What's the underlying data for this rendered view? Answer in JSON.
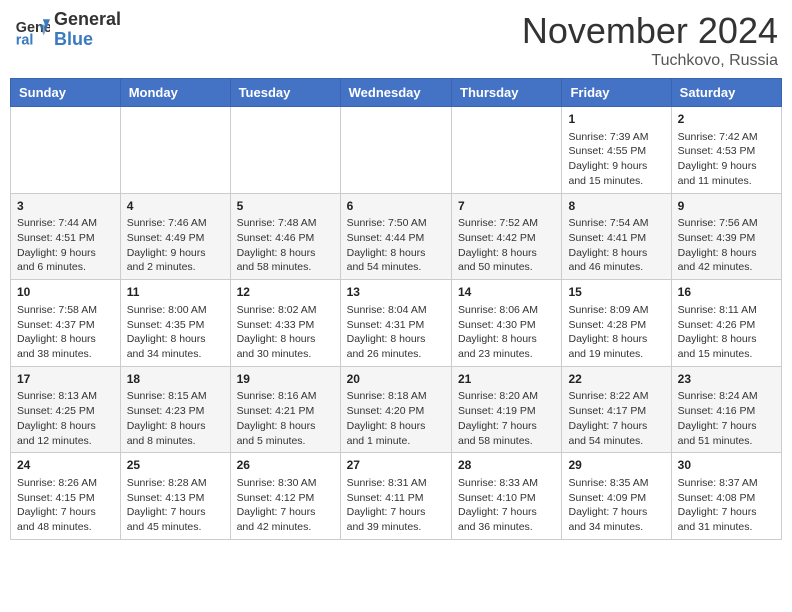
{
  "header": {
    "logo_general": "General",
    "logo_blue": "Blue",
    "month_title": "November 2024",
    "location": "Tuchkovo, Russia"
  },
  "weekdays": [
    "Sunday",
    "Monday",
    "Tuesday",
    "Wednesday",
    "Thursday",
    "Friday",
    "Saturday"
  ],
  "weeks": [
    [
      {
        "day": "",
        "info": ""
      },
      {
        "day": "",
        "info": ""
      },
      {
        "day": "",
        "info": ""
      },
      {
        "day": "",
        "info": ""
      },
      {
        "day": "",
        "info": ""
      },
      {
        "day": "1",
        "info": "Sunrise: 7:39 AM\nSunset: 4:55 PM\nDaylight: 9 hours and 15 minutes."
      },
      {
        "day": "2",
        "info": "Sunrise: 7:42 AM\nSunset: 4:53 PM\nDaylight: 9 hours and 11 minutes."
      }
    ],
    [
      {
        "day": "3",
        "info": "Sunrise: 7:44 AM\nSunset: 4:51 PM\nDaylight: 9 hours and 6 minutes."
      },
      {
        "day": "4",
        "info": "Sunrise: 7:46 AM\nSunset: 4:49 PM\nDaylight: 9 hours and 2 minutes."
      },
      {
        "day": "5",
        "info": "Sunrise: 7:48 AM\nSunset: 4:46 PM\nDaylight: 8 hours and 58 minutes."
      },
      {
        "day": "6",
        "info": "Sunrise: 7:50 AM\nSunset: 4:44 PM\nDaylight: 8 hours and 54 minutes."
      },
      {
        "day": "7",
        "info": "Sunrise: 7:52 AM\nSunset: 4:42 PM\nDaylight: 8 hours and 50 minutes."
      },
      {
        "day": "8",
        "info": "Sunrise: 7:54 AM\nSunset: 4:41 PM\nDaylight: 8 hours and 46 minutes."
      },
      {
        "day": "9",
        "info": "Sunrise: 7:56 AM\nSunset: 4:39 PM\nDaylight: 8 hours and 42 minutes."
      }
    ],
    [
      {
        "day": "10",
        "info": "Sunrise: 7:58 AM\nSunset: 4:37 PM\nDaylight: 8 hours and 38 minutes."
      },
      {
        "day": "11",
        "info": "Sunrise: 8:00 AM\nSunset: 4:35 PM\nDaylight: 8 hours and 34 minutes."
      },
      {
        "day": "12",
        "info": "Sunrise: 8:02 AM\nSunset: 4:33 PM\nDaylight: 8 hours and 30 minutes."
      },
      {
        "day": "13",
        "info": "Sunrise: 8:04 AM\nSunset: 4:31 PM\nDaylight: 8 hours and 26 minutes."
      },
      {
        "day": "14",
        "info": "Sunrise: 8:06 AM\nSunset: 4:30 PM\nDaylight: 8 hours and 23 minutes."
      },
      {
        "day": "15",
        "info": "Sunrise: 8:09 AM\nSunset: 4:28 PM\nDaylight: 8 hours and 19 minutes."
      },
      {
        "day": "16",
        "info": "Sunrise: 8:11 AM\nSunset: 4:26 PM\nDaylight: 8 hours and 15 minutes."
      }
    ],
    [
      {
        "day": "17",
        "info": "Sunrise: 8:13 AM\nSunset: 4:25 PM\nDaylight: 8 hours and 12 minutes."
      },
      {
        "day": "18",
        "info": "Sunrise: 8:15 AM\nSunset: 4:23 PM\nDaylight: 8 hours and 8 minutes."
      },
      {
        "day": "19",
        "info": "Sunrise: 8:16 AM\nSunset: 4:21 PM\nDaylight: 8 hours and 5 minutes."
      },
      {
        "day": "20",
        "info": "Sunrise: 8:18 AM\nSunset: 4:20 PM\nDaylight: 8 hours and 1 minute."
      },
      {
        "day": "21",
        "info": "Sunrise: 8:20 AM\nSunset: 4:19 PM\nDaylight: 7 hours and 58 minutes."
      },
      {
        "day": "22",
        "info": "Sunrise: 8:22 AM\nSunset: 4:17 PM\nDaylight: 7 hours and 54 minutes."
      },
      {
        "day": "23",
        "info": "Sunrise: 8:24 AM\nSunset: 4:16 PM\nDaylight: 7 hours and 51 minutes."
      }
    ],
    [
      {
        "day": "24",
        "info": "Sunrise: 8:26 AM\nSunset: 4:15 PM\nDaylight: 7 hours and 48 minutes."
      },
      {
        "day": "25",
        "info": "Sunrise: 8:28 AM\nSunset: 4:13 PM\nDaylight: 7 hours and 45 minutes."
      },
      {
        "day": "26",
        "info": "Sunrise: 8:30 AM\nSunset: 4:12 PM\nDaylight: 7 hours and 42 minutes."
      },
      {
        "day": "27",
        "info": "Sunrise: 8:31 AM\nSunset: 4:11 PM\nDaylight: 7 hours and 39 minutes."
      },
      {
        "day": "28",
        "info": "Sunrise: 8:33 AM\nSunset: 4:10 PM\nDaylight: 7 hours and 36 minutes."
      },
      {
        "day": "29",
        "info": "Sunrise: 8:35 AM\nSunset: 4:09 PM\nDaylight: 7 hours and 34 minutes."
      },
      {
        "day": "30",
        "info": "Sunrise: 8:37 AM\nSunset: 4:08 PM\nDaylight: 7 hours and 31 minutes."
      }
    ]
  ]
}
